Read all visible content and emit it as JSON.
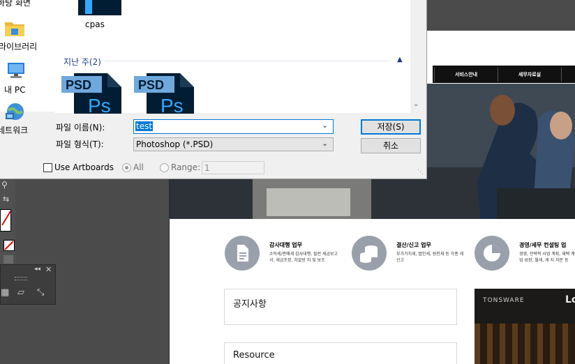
{
  "dialog": {
    "nav_items": [
      {
        "label": "바탕 화면",
        "icon": "desktop-icon"
      },
      {
        "label": "라이브러리",
        "icon": "library-folder-icon"
      },
      {
        "label": "내 PC",
        "icon": "pc-icon"
      },
      {
        "label": "네트워크",
        "icon": "network-icon"
      }
    ],
    "files_top": [
      {
        "name": "cpas",
        "type": "PSD"
      }
    ],
    "group_header": "지난 주(2)",
    "files_group": [
      {
        "type": "PSD"
      },
      {
        "type": "PSD"
      }
    ],
    "filename_label": "파일 이름(N):",
    "filename_value": "test",
    "filetype_label": "파일 형식(T):",
    "filetype_value": "Photoshop (*.PSD)",
    "save_button": "저장(S)",
    "cancel_button": "취소",
    "use_artboards_label": "Use Artboards",
    "radio_all_label": "All",
    "radio_range_label": "Range:",
    "range_value": "1"
  },
  "canvas": {
    "nav_items": [
      "서비스안내",
      "세무자료실"
    ],
    "services": [
      {
        "title": "감사대행 업무",
        "desc": "소득세/판매세 감사대행, 될런 세금보고서, 세금조정, 차알방 지 및 보조",
        "icon": "document-icon"
      },
      {
        "title": "결산/신고 업무",
        "desc": "부가가치세, 법인세, 원천세 등 각종 세 신고",
        "icon": "coins-icon"
      },
      {
        "title": "경영/세무 컨설팅 업",
        "desc": "경영, 전략적 사업 계획, 재택 계획 등 기업 성장, 월세, 세 지 자문 등",
        "icon": "pie-chart-icon"
      }
    ],
    "notice_title": "공지사항",
    "resource_title": "Resource",
    "photo_sign": "TONSWARE",
    "photo_sign_right": "Lo"
  },
  "colors": {
    "selection_blue": "#0078d7",
    "group_header_blue": "#1e3c8c",
    "psd_dark": "#001d34",
    "psd_light": "#6fa8dc",
    "service_circle": "#9aa0ab"
  }
}
